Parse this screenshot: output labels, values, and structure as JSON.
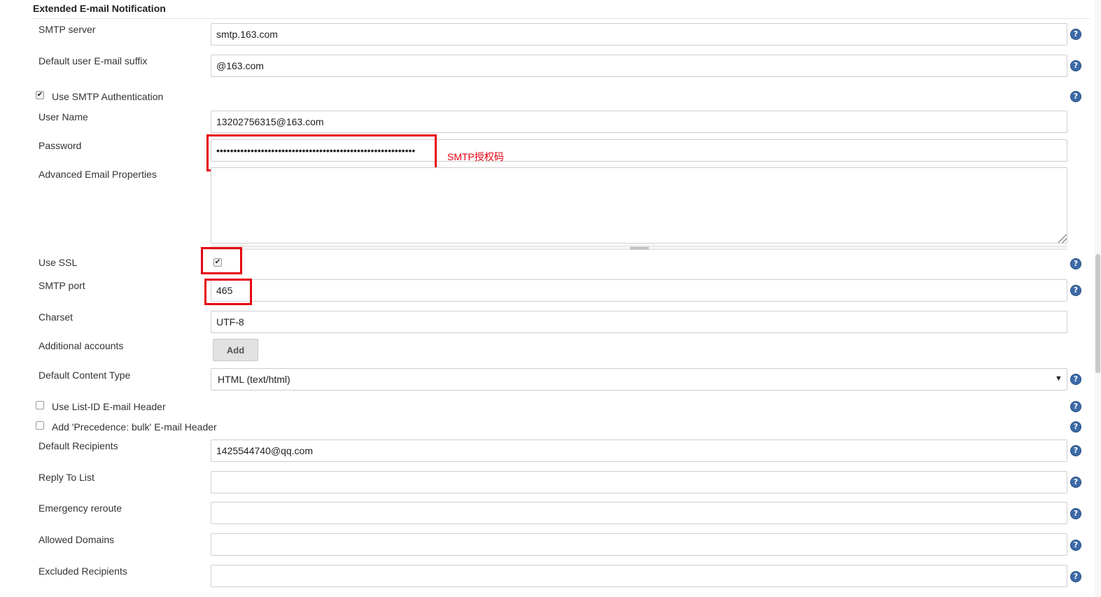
{
  "section": {
    "title": "Extended E-mail Notification"
  },
  "smtp_server": {
    "label": "SMTP server",
    "value": "smtp.163.com"
  },
  "default_suffix": {
    "label": "Default user E-mail suffix",
    "value": "@163.com"
  },
  "use_smtp_auth": {
    "label": "Use SMTP Authentication",
    "checked": true
  },
  "user_name": {
    "label": "User Name",
    "value": "13202756315@163.com"
  },
  "password": {
    "label": "Password",
    "value": "••••••••••••••••••••••••••••••••••••••••••••••••••••••••••"
  },
  "annotation": {
    "text": "SMTP授权码",
    "color": "#e60012"
  },
  "advanced_props": {
    "label": "Advanced Email Properties",
    "value": ""
  },
  "use_ssl": {
    "label": "Use SSL",
    "checked": true
  },
  "smtp_port": {
    "label": "SMTP port",
    "value": "465"
  },
  "charset": {
    "label": "Charset",
    "value": "UTF-8"
  },
  "additional_accounts": {
    "label": "Additional accounts",
    "button": "Add"
  },
  "content_type": {
    "label": "Default Content Type",
    "value": "HTML (text/html)",
    "arrow": "▼"
  },
  "list_id_header": {
    "label": "Use List-ID E-mail Header",
    "checked": false
  },
  "precedence_header": {
    "label": "Add 'Precedence: bulk' E-mail Header",
    "checked": false
  },
  "default_recipients": {
    "label": "Default Recipients",
    "value": "1425544740@qq.com"
  },
  "reply_to": {
    "label": "Reply To List",
    "value": ""
  },
  "emergency_reroute": {
    "label": "Emergency reroute",
    "value": ""
  },
  "allowed_domains": {
    "label": "Allowed Domains",
    "value": ""
  },
  "excluded_recipients": {
    "label": "Excluded Recipients",
    "value": ""
  },
  "icons": {
    "help": "?",
    "check": "✔"
  },
  "colors": {
    "help_icon": "#3c6aa8",
    "highlight": "#e60012"
  }
}
